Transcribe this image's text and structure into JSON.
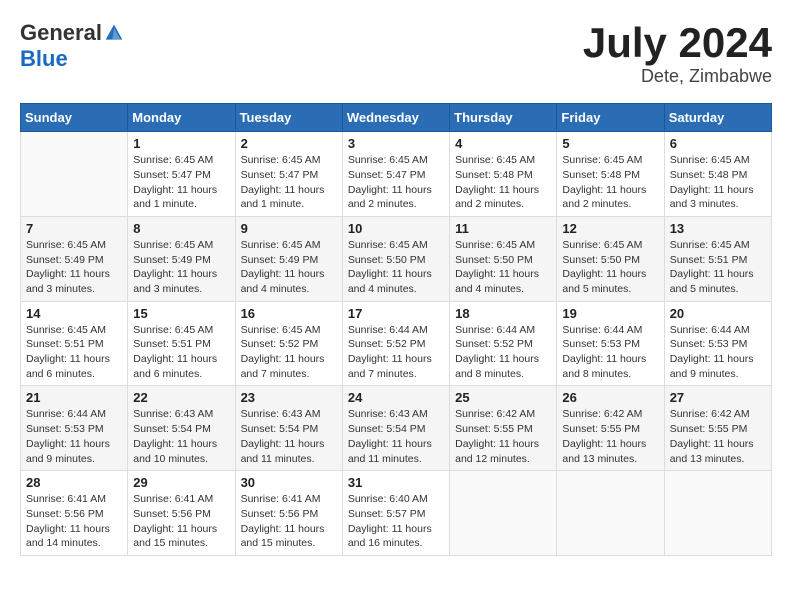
{
  "header": {
    "logo_general": "General",
    "logo_blue": "Blue",
    "month_title": "July 2024",
    "location": "Dete, Zimbabwe"
  },
  "weekdays": [
    "Sunday",
    "Monday",
    "Tuesday",
    "Wednesday",
    "Thursday",
    "Friday",
    "Saturday"
  ],
  "weeks": [
    [
      {
        "day": "",
        "info": ""
      },
      {
        "day": "1",
        "info": "Sunrise: 6:45 AM\nSunset: 5:47 PM\nDaylight: 11 hours\nand 1 minute."
      },
      {
        "day": "2",
        "info": "Sunrise: 6:45 AM\nSunset: 5:47 PM\nDaylight: 11 hours\nand 1 minute."
      },
      {
        "day": "3",
        "info": "Sunrise: 6:45 AM\nSunset: 5:47 PM\nDaylight: 11 hours\nand 2 minutes."
      },
      {
        "day": "4",
        "info": "Sunrise: 6:45 AM\nSunset: 5:48 PM\nDaylight: 11 hours\nand 2 minutes."
      },
      {
        "day": "5",
        "info": "Sunrise: 6:45 AM\nSunset: 5:48 PM\nDaylight: 11 hours\nand 2 minutes."
      },
      {
        "day": "6",
        "info": "Sunrise: 6:45 AM\nSunset: 5:48 PM\nDaylight: 11 hours\nand 3 minutes."
      }
    ],
    [
      {
        "day": "7",
        "info": "Sunrise: 6:45 AM\nSunset: 5:49 PM\nDaylight: 11 hours\nand 3 minutes."
      },
      {
        "day": "8",
        "info": "Sunrise: 6:45 AM\nSunset: 5:49 PM\nDaylight: 11 hours\nand 3 minutes."
      },
      {
        "day": "9",
        "info": "Sunrise: 6:45 AM\nSunset: 5:49 PM\nDaylight: 11 hours\nand 4 minutes."
      },
      {
        "day": "10",
        "info": "Sunrise: 6:45 AM\nSunset: 5:50 PM\nDaylight: 11 hours\nand 4 minutes."
      },
      {
        "day": "11",
        "info": "Sunrise: 6:45 AM\nSunset: 5:50 PM\nDaylight: 11 hours\nand 4 minutes."
      },
      {
        "day": "12",
        "info": "Sunrise: 6:45 AM\nSunset: 5:50 PM\nDaylight: 11 hours\nand 5 minutes."
      },
      {
        "day": "13",
        "info": "Sunrise: 6:45 AM\nSunset: 5:51 PM\nDaylight: 11 hours\nand 5 minutes."
      }
    ],
    [
      {
        "day": "14",
        "info": "Sunrise: 6:45 AM\nSunset: 5:51 PM\nDaylight: 11 hours\nand 6 minutes."
      },
      {
        "day": "15",
        "info": "Sunrise: 6:45 AM\nSunset: 5:51 PM\nDaylight: 11 hours\nand 6 minutes."
      },
      {
        "day": "16",
        "info": "Sunrise: 6:45 AM\nSunset: 5:52 PM\nDaylight: 11 hours\nand 7 minutes."
      },
      {
        "day": "17",
        "info": "Sunrise: 6:44 AM\nSunset: 5:52 PM\nDaylight: 11 hours\nand 7 minutes."
      },
      {
        "day": "18",
        "info": "Sunrise: 6:44 AM\nSunset: 5:52 PM\nDaylight: 11 hours\nand 8 minutes."
      },
      {
        "day": "19",
        "info": "Sunrise: 6:44 AM\nSunset: 5:53 PM\nDaylight: 11 hours\nand 8 minutes."
      },
      {
        "day": "20",
        "info": "Sunrise: 6:44 AM\nSunset: 5:53 PM\nDaylight: 11 hours\nand 9 minutes."
      }
    ],
    [
      {
        "day": "21",
        "info": "Sunrise: 6:44 AM\nSunset: 5:53 PM\nDaylight: 11 hours\nand 9 minutes."
      },
      {
        "day": "22",
        "info": "Sunrise: 6:43 AM\nSunset: 5:54 PM\nDaylight: 11 hours\nand 10 minutes."
      },
      {
        "day": "23",
        "info": "Sunrise: 6:43 AM\nSunset: 5:54 PM\nDaylight: 11 hours\nand 11 minutes."
      },
      {
        "day": "24",
        "info": "Sunrise: 6:43 AM\nSunset: 5:54 PM\nDaylight: 11 hours\nand 11 minutes."
      },
      {
        "day": "25",
        "info": "Sunrise: 6:42 AM\nSunset: 5:55 PM\nDaylight: 11 hours\nand 12 minutes."
      },
      {
        "day": "26",
        "info": "Sunrise: 6:42 AM\nSunset: 5:55 PM\nDaylight: 11 hours\nand 13 minutes."
      },
      {
        "day": "27",
        "info": "Sunrise: 6:42 AM\nSunset: 5:55 PM\nDaylight: 11 hours\nand 13 minutes."
      }
    ],
    [
      {
        "day": "28",
        "info": "Sunrise: 6:41 AM\nSunset: 5:56 PM\nDaylight: 11 hours\nand 14 minutes."
      },
      {
        "day": "29",
        "info": "Sunrise: 6:41 AM\nSunset: 5:56 PM\nDaylight: 11 hours\nand 15 minutes."
      },
      {
        "day": "30",
        "info": "Sunrise: 6:41 AM\nSunset: 5:56 PM\nDaylight: 11 hours\nand 15 minutes."
      },
      {
        "day": "31",
        "info": "Sunrise: 6:40 AM\nSunset: 5:57 PM\nDaylight: 11 hours\nand 16 minutes."
      },
      {
        "day": "",
        "info": ""
      },
      {
        "day": "",
        "info": ""
      },
      {
        "day": "",
        "info": ""
      }
    ]
  ]
}
